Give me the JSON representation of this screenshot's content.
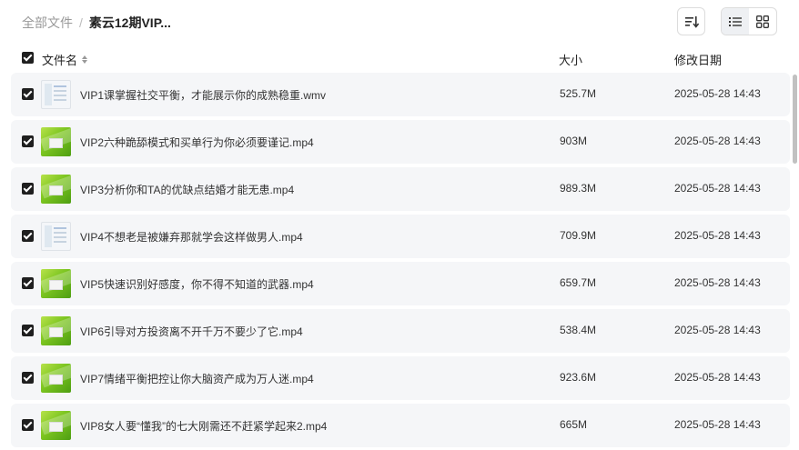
{
  "breadcrumb": {
    "root": "全部文件",
    "separator": "/",
    "current": "素云12期VIP..."
  },
  "toolbar": {
    "sort_icon": "sort-desc-icon",
    "list_view_icon": "list-view-icon",
    "grid_view_icon": "grid-view-icon"
  },
  "columns": {
    "name": "文件名",
    "size": "大小",
    "date": "修改日期"
  },
  "files": [
    {
      "name": "VIP1课掌握社交平衡，才能展示你的成熟稳重.wmv",
      "size": "525.7M",
      "date": "2025-05-28 14:43",
      "thumb": "screenshot"
    },
    {
      "name": "VIP2六种跪舔模式和买单行为你必须要谨记.mp4",
      "size": "903M",
      "date": "2025-05-28 14:43",
      "thumb": "video"
    },
    {
      "name": "VIP3分析你和TA的优缺点结婚才能无患.mp4",
      "size": "989.3M",
      "date": "2025-05-28 14:43",
      "thumb": "video"
    },
    {
      "name": "VIP4不想老是被嫌弃那就学会这样做男人.mp4",
      "size": "709.9M",
      "date": "2025-05-28 14:43",
      "thumb": "screenshot"
    },
    {
      "name": "VIP5快速识别好感度，你不得不知道的武器.mp4",
      "size": "659.7M",
      "date": "2025-05-28 14:43",
      "thumb": "video"
    },
    {
      "name": "VIP6引导对方投资离不开千万不要少了它.mp4",
      "size": "538.4M",
      "date": "2025-05-28 14:43",
      "thumb": "video"
    },
    {
      "name": "VIP7情绪平衡把控让你大脑资产成为万人迷.mp4",
      "size": "923.6M",
      "date": "2025-05-28 14:43",
      "thumb": "video"
    },
    {
      "name": "VIP8女人要“懂我”的七大刚需还不赶紧学起来2.mp4",
      "size": "665M",
      "date": "2025-05-28 14:43",
      "thumb": "video"
    }
  ]
}
